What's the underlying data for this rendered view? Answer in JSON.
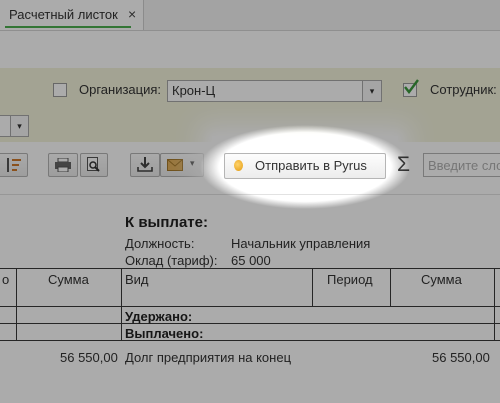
{
  "tab": {
    "label": "Расчетный листок",
    "close": "×"
  },
  "filters": {
    "org_label": "Организация:",
    "org_value": "Крон-Ц",
    "emp_label": "Сотрудник:",
    "dropdown_arrow": "▾",
    "org_checked": false,
    "emp_checked": true
  },
  "toolbar": {
    "pyrus_label": "Отправить в Pyrus",
    "sigma": "Σ",
    "search_placeholder": "Введите сло"
  },
  "report": {
    "title": "К выплате:",
    "position_label": "Должность:",
    "position_value": "Начальник управления",
    "salary_label": "Оклад (тариф):",
    "salary_value": "65 000",
    "table": {
      "headers_left": [
        "о",
        "Сумма"
      ],
      "headers_right": [
        "Вид",
        "Период",
        "Сумма"
      ],
      "withheld": "Удержано:",
      "paid": "Выплачено:",
      "left_amount": "56 550,00",
      "debt_label": "Долг предприятия на конец",
      "right_amount": "56 550,00"
    }
  },
  "colors": {
    "filter_bg": "#f3f3dc",
    "tab_accent": "#4caf50",
    "overlay": "rgba(0,0,0,0.33)"
  }
}
